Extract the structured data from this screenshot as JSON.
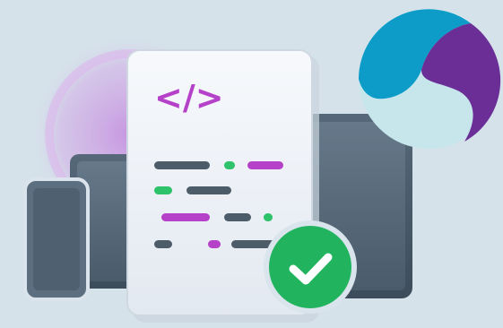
{
  "illustration": {
    "code_glyph": "</>",
    "colors": {
      "background": "#d5e2ea",
      "purple_accent": "#b641c9",
      "green_accent": "#2ec26a",
      "check_badge": "#22b35e",
      "device_dark": "#4a5b6a",
      "logo_blue": "#0c9cc7",
      "logo_purple": "#6a2e96",
      "logo_pale": "#c6e6ec"
    },
    "icons": [
      "code-brackets-icon",
      "checkmark-icon",
      "phone-icon",
      "tablet-icon",
      "monitor-icon",
      "brand-logo-icon"
    ]
  }
}
